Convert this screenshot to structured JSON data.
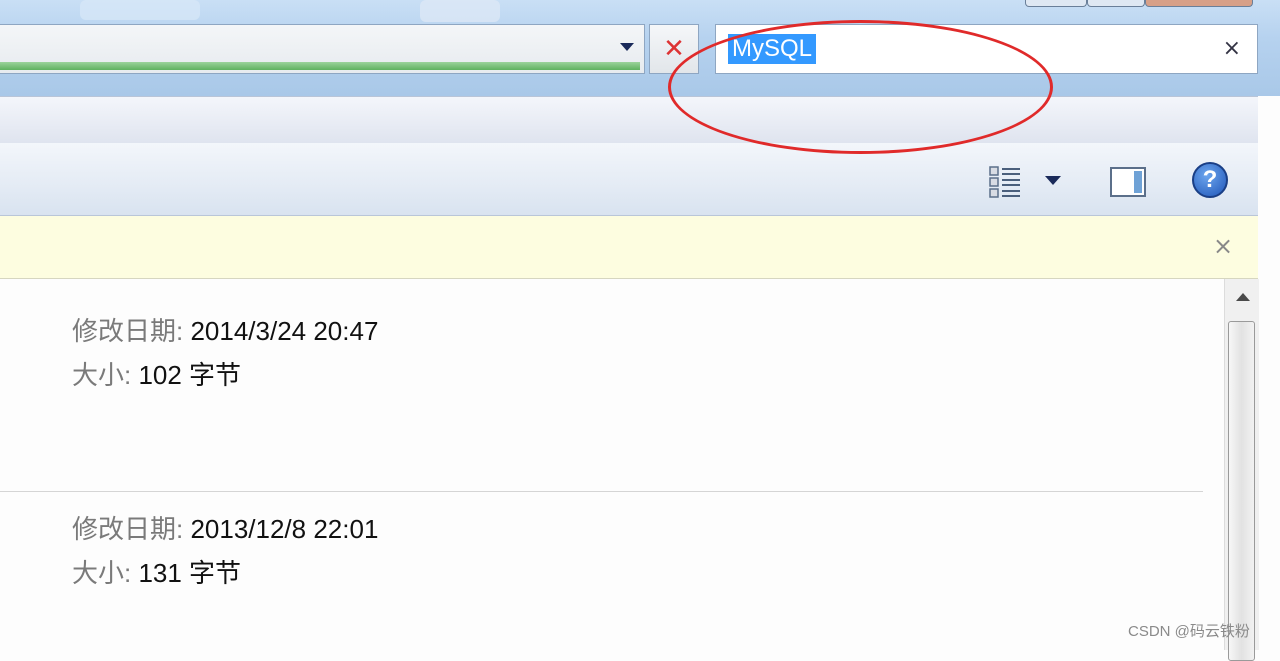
{
  "search": {
    "value": "MySQL",
    "clear_glyph": "×"
  },
  "address_bar": {
    "dropdown_icon": "chevron-down-icon",
    "stop_glyph": "✕"
  },
  "toolbar": {
    "views_icon": "views-icon",
    "preview_pane_icon": "preview-pane-icon",
    "help_glyph": "?"
  },
  "infobar": {
    "close_glyph": "×"
  },
  "results": [
    {
      "modified_label": "修改日期: ",
      "modified_value": "2014/3/24 20:47",
      "size_label": "大小: ",
      "size_value": "102 字节"
    },
    {
      "modified_label": "修改日期: ",
      "modified_value": "2013/12/8 22:01",
      "size_label": "大小: ",
      "size_value": "131 字节"
    }
  ],
  "watermark": "CSDN @码云铁粉",
  "colors": {
    "annotation_circle": "#e02a2a",
    "selection": "#3399ff"
  }
}
